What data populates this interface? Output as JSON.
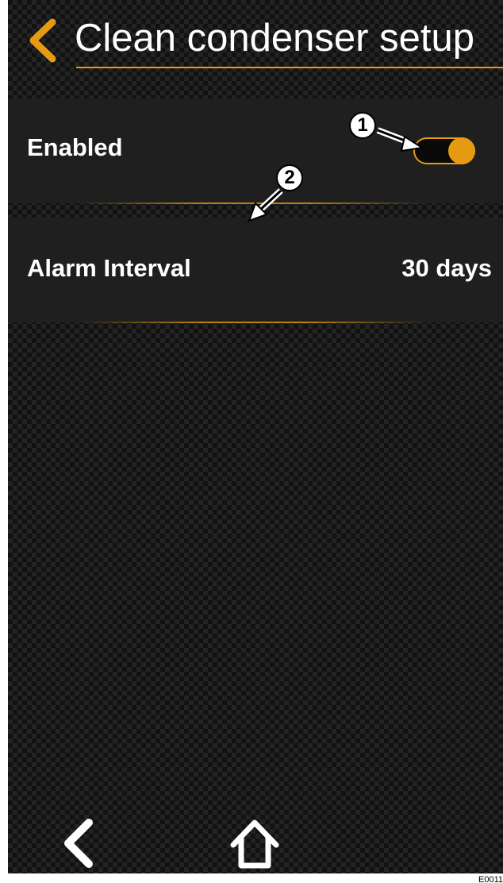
{
  "header": {
    "title": "Clean condenser setup",
    "back_icon": "chevron-left-icon"
  },
  "settings": {
    "enabled": {
      "label": "Enabled",
      "toggle_state": "on"
    },
    "alarm_interval": {
      "label": "Alarm Interval",
      "value": "30 days"
    }
  },
  "callouts": [
    "1",
    "2"
  ],
  "footer": {
    "back_icon": "chevron-left-icon",
    "home_icon": "home-icon"
  },
  "figure_code": "E0011",
  "colors": {
    "accent": "#e59a12",
    "background": "#121212",
    "row_background": "#1f1f1f",
    "text": "#ffffff"
  }
}
